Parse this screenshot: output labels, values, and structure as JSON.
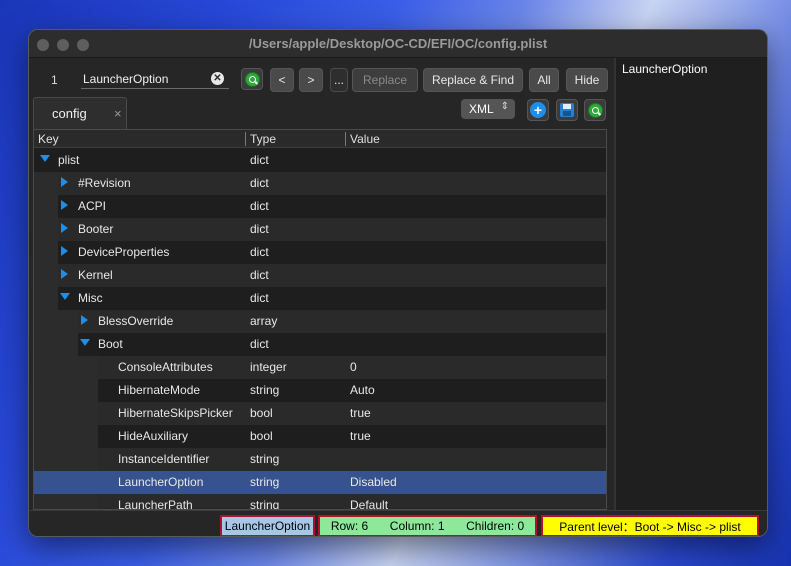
{
  "window": {
    "title": "/Users/apple/Desktop/OC-CD/EFI/OC/config.plist"
  },
  "find": {
    "count": "1",
    "query": "LauncherOption",
    "prev_label": "<",
    "next_label": ">",
    "more_label": "...",
    "replace_label": "Replace",
    "replace_find_label": "Replace & Find",
    "all_label": "All",
    "hide_label": "Hide"
  },
  "tab": {
    "label": "config",
    "close": "×"
  },
  "toolbar": {
    "format": "XML",
    "format_chevron": "⌃⌄"
  },
  "columns": {
    "key": "Key",
    "type": "Type",
    "value": "Value"
  },
  "rows": [
    {
      "key": "plist",
      "type": "dict",
      "value": "",
      "level": 0,
      "toggle": "down"
    },
    {
      "key": "#Revision",
      "type": "dict",
      "value": "",
      "level": 1,
      "toggle": "right"
    },
    {
      "key": "ACPI",
      "type": "dict",
      "value": "",
      "level": 1,
      "toggle": "right"
    },
    {
      "key": "Booter",
      "type": "dict",
      "value": "",
      "level": 1,
      "toggle": "right"
    },
    {
      "key": "DeviceProperties",
      "type": "dict",
      "value": "",
      "level": 1,
      "toggle": "right"
    },
    {
      "key": "Kernel",
      "type": "dict",
      "value": "",
      "level": 1,
      "toggle": "right"
    },
    {
      "key": "Misc",
      "type": "dict",
      "value": "",
      "level": 1,
      "toggle": "down"
    },
    {
      "key": "BlessOverride",
      "type": "array",
      "value": "",
      "level": 2,
      "toggle": "right"
    },
    {
      "key": "Boot",
      "type": "dict",
      "value": "",
      "level": 2,
      "toggle": "down"
    },
    {
      "key": "ConsoleAttributes",
      "type": "integer",
      "value": "0",
      "level": 3,
      "toggle": ""
    },
    {
      "key": "HibernateMode",
      "type": "string",
      "value": "Auto",
      "level": 3,
      "toggle": ""
    },
    {
      "key": "HibernateSkipsPicker",
      "type": "bool",
      "value": "true",
      "level": 3,
      "toggle": ""
    },
    {
      "key": "HideAuxiliary",
      "type": "bool",
      "value": "true",
      "level": 3,
      "toggle": ""
    },
    {
      "key": "InstanceIdentifier",
      "type": "string",
      "value": "",
      "level": 3,
      "toggle": ""
    },
    {
      "key": "LauncherOption",
      "type": "string",
      "value": "Disabled",
      "level": 3,
      "toggle": "",
      "selected": true
    },
    {
      "key": "LauncherPath",
      "type": "string",
      "value": "Default",
      "level": 3,
      "toggle": ""
    }
  ],
  "right_panel": {
    "text": "LauncherOption"
  },
  "status": {
    "current_key": "LauncherOption",
    "row": "Row: 6",
    "column": "Column: 1",
    "children": "Children: 0",
    "parent": "Parent level：Boot -> Misc -> plist"
  },
  "colors": {
    "accent": "#1e8ee8",
    "selection": "#36528f",
    "status_key_bg": "#a8c6e8",
    "status_pos_bg": "#8ee89a",
    "status_parent_bg": "#ffff00",
    "status_border": "#b0122a"
  }
}
